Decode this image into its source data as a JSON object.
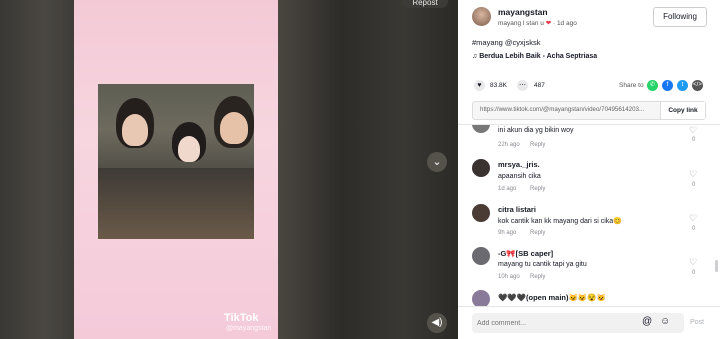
{
  "video": {
    "repost_label": "Repost",
    "watermark_logo": "TikTok",
    "watermark_user": "@mayangstan"
  },
  "author": {
    "username": "mayangstan",
    "subline": "mayang l stan u",
    "heart_emoji": "❤",
    "time_ago": "1d ago",
    "follow_label": "Following"
  },
  "post": {
    "caption": "#mayang @cyxjsksk",
    "music": "Berdua Lebih Baik - Acha Septriasa",
    "likes": "83.8K",
    "comments_count": "487",
    "share_label": "Share to",
    "link_url": "https://www.tiktok.com/@mayangstan/video/70495614203...",
    "copy_label": "Copy link"
  },
  "comments": [
    {
      "name": "",
      "text": "ini akun dia yg bikin woy",
      "time": "22h ago",
      "reply": "Reply",
      "likes": "0"
    },
    {
      "name": "mrsya._jris.",
      "text": "apaansih cika",
      "time": "1d ago",
      "reply": "Reply",
      "likes": "0"
    },
    {
      "name": "citra listari",
      "text": "kok cantik kan kk mayang dari si cika😊",
      "time": "9h ago",
      "reply": "Reply",
      "likes": "0"
    },
    {
      "name": "-G🎀[SB caper]",
      "text": "mayang tu cantik tapi ya gitu",
      "time": "10h ago",
      "reply": "Reply",
      "likes": "0"
    },
    {
      "name": "🖤🖤🖤(open main)😺😺😵😺",
      "text": "",
      "time": "",
      "reply": "",
      "likes": ""
    }
  ],
  "composer": {
    "placeholder": "Add comment...",
    "post_label": "Post"
  },
  "icons": {
    "share": [
      "whatsapp-icon",
      "facebook-icon",
      "twitter-icon",
      "embed-icon"
    ]
  },
  "colors": {
    "whatsapp": "#25d366",
    "facebook": "#1877f2",
    "twitter": "#1d9bf0",
    "embed": "#555555"
  }
}
